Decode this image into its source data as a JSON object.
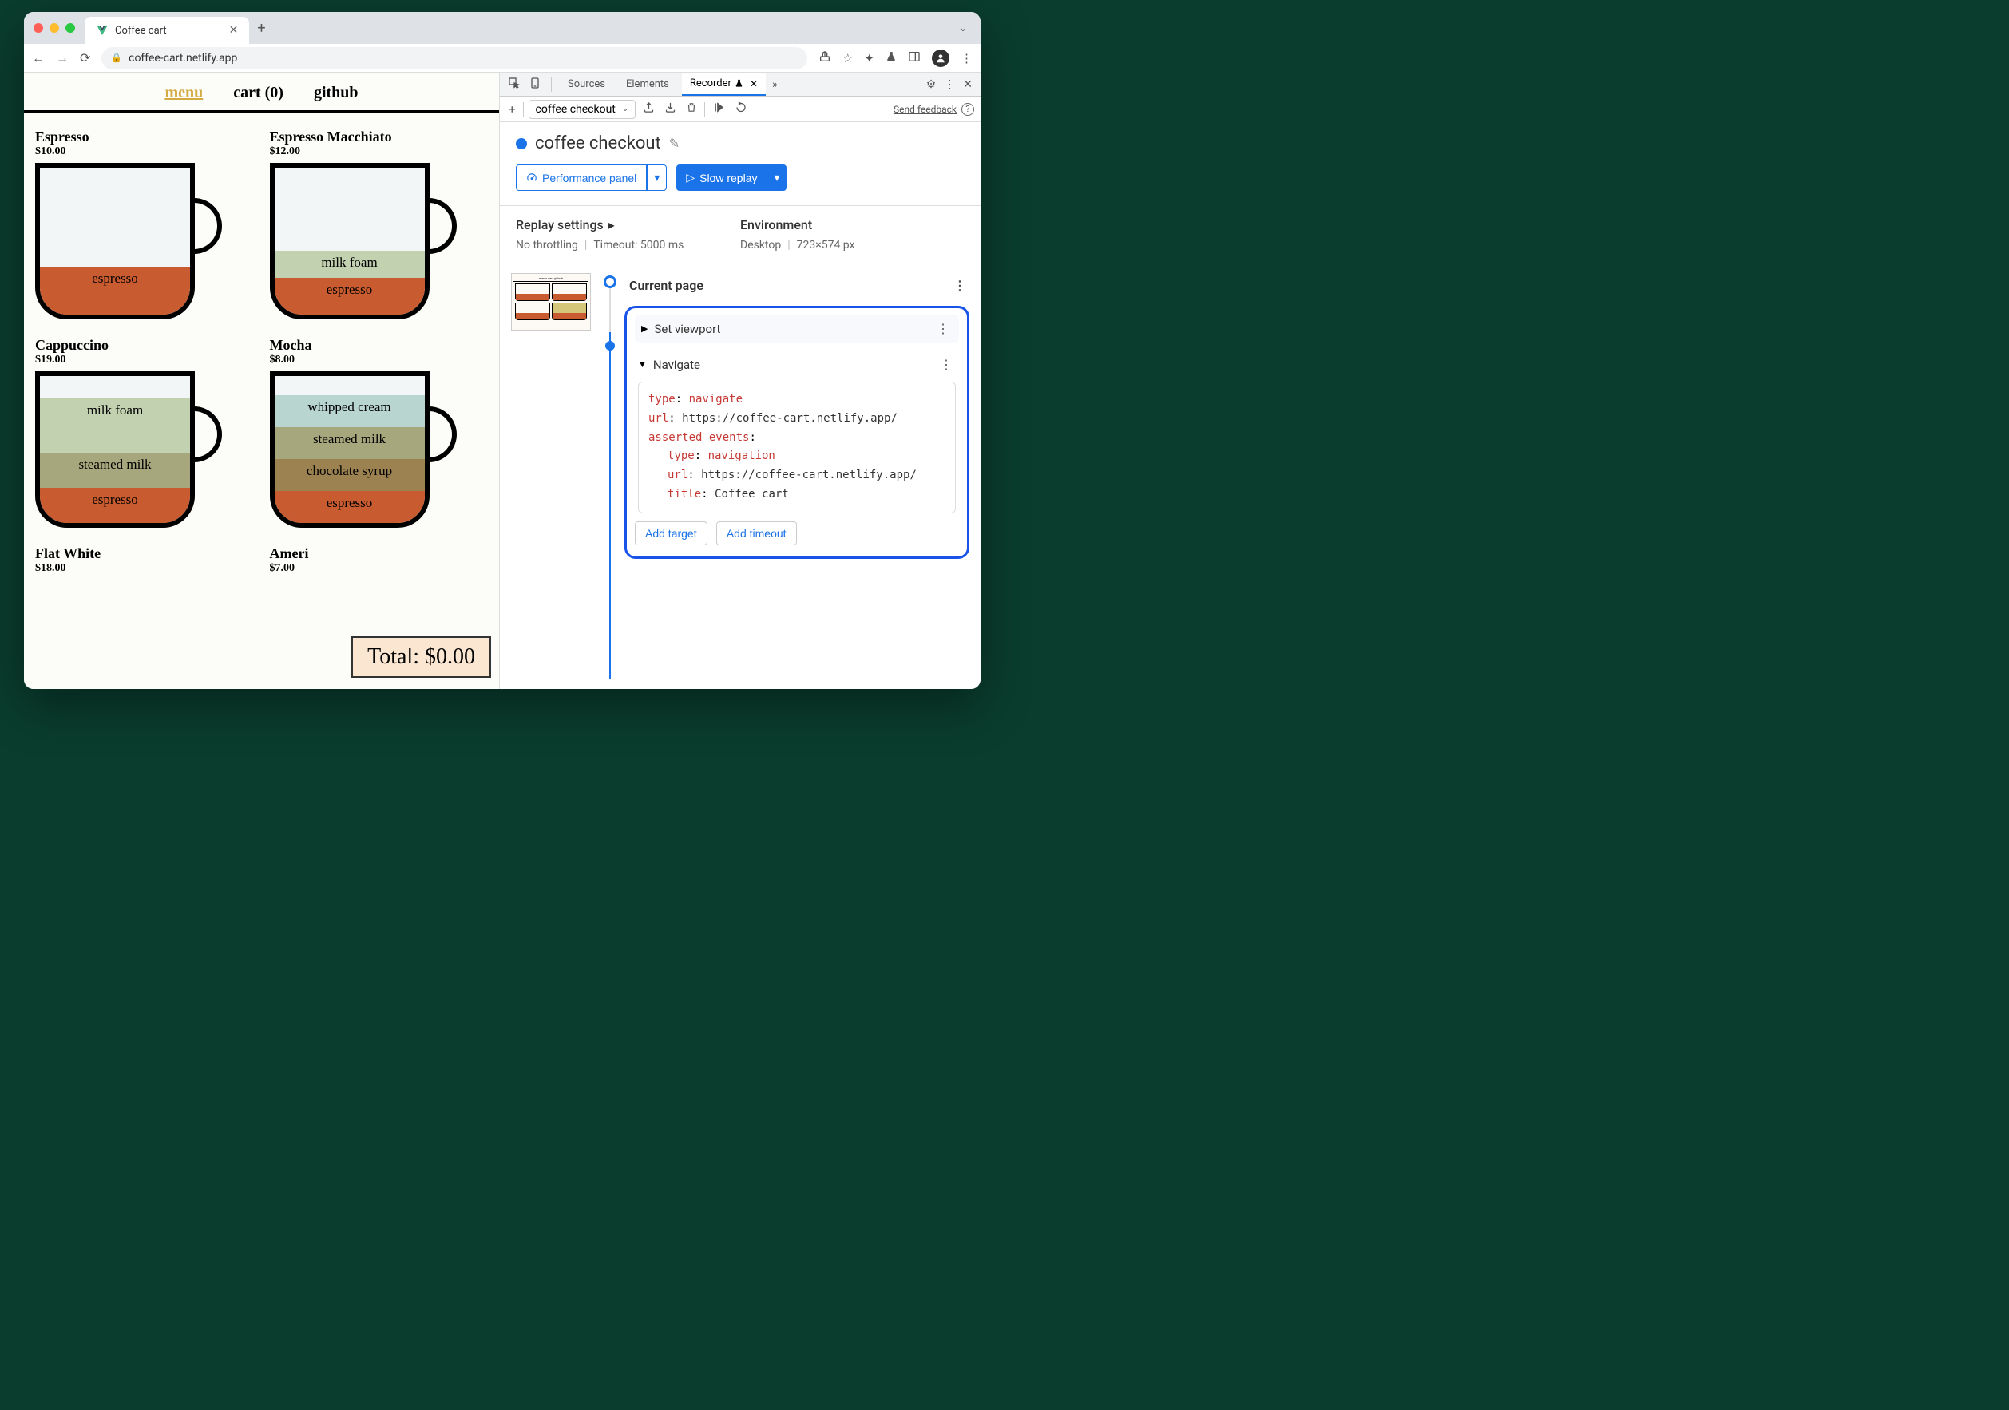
{
  "tab": {
    "title": "Coffee cart"
  },
  "url": "coffee-cart.netlify.app",
  "nav": {
    "menu": "menu",
    "cart": "cart (0)",
    "github": "github"
  },
  "products": [
    {
      "name": "Espresso",
      "price": "$10.00"
    },
    {
      "name": "Espresso Macchiato",
      "price": "$12.00"
    },
    {
      "name": "Cappuccino",
      "price": "$19.00"
    },
    {
      "name": "Mocha",
      "price": "$8.00"
    },
    {
      "name": "Flat White",
      "price": "$18.00"
    },
    {
      "name": "Ameri",
      "price": "$7.00"
    }
  ],
  "layers": {
    "espresso": "espresso",
    "milk_foam": "milk foam",
    "steamed_milk": "steamed milk",
    "whipped_cream": "whipped cream",
    "chocolate_syrup": "chocolate syrup"
  },
  "total": "Total: $0.00",
  "devtools": {
    "tabs": {
      "sources": "Sources",
      "elements": "Elements",
      "recorder": "Recorder"
    },
    "recording_select": "coffee checkout",
    "feedback": "Send feedback",
    "recording_title": "coffee checkout",
    "perf_btn": "Performance panel",
    "replay_btn": "Slow replay",
    "settings": {
      "replay_title": "Replay settings",
      "throttling": "No throttling",
      "timeout": "Timeout: 5000 ms",
      "env_title": "Environment",
      "device": "Desktop",
      "viewport": "723×574 px"
    },
    "steps": {
      "current": "Current page",
      "set_viewport": "Set viewport",
      "navigate": "Navigate",
      "code": {
        "type_k": "type",
        "type_v": "navigate",
        "url_k": "url",
        "url_v": "https://coffee-cart.netlify.app/",
        "asserted_k": "asserted events",
        "nav_type_v": "navigation",
        "title_k": "title",
        "title_v": "Coffee cart"
      },
      "add_target": "Add target",
      "add_timeout": "Add timeout"
    }
  }
}
